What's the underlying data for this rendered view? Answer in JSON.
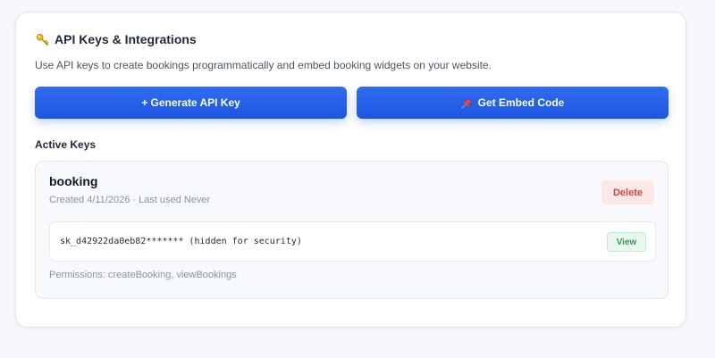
{
  "header": {
    "title": "API Keys & Integrations",
    "title_icon": "key-icon",
    "description": "Use API keys to create bookings programmatically and embed booking widgets on your website."
  },
  "actions": {
    "generate_label": "+ Generate API Key",
    "embed_label": "Get Embed Code",
    "embed_icon": "pushpin-icon"
  },
  "active_keys": {
    "section_title": "Active Keys",
    "keys": [
      {
        "name": "booking",
        "meta": "Created 4/11/2026 · Last used Never",
        "delete_label": "Delete",
        "secret": "sk_d42922da0eb82******* (hidden for security)",
        "view_label": "View",
        "permissions": "Permissions: createBooking, viewBookings"
      }
    ]
  },
  "colors": {
    "primary": "#2563eb",
    "danger": "#d64545",
    "danger_bg": "#fde8e8",
    "success": "#23a25a",
    "success_bg": "#e9f8ee"
  }
}
